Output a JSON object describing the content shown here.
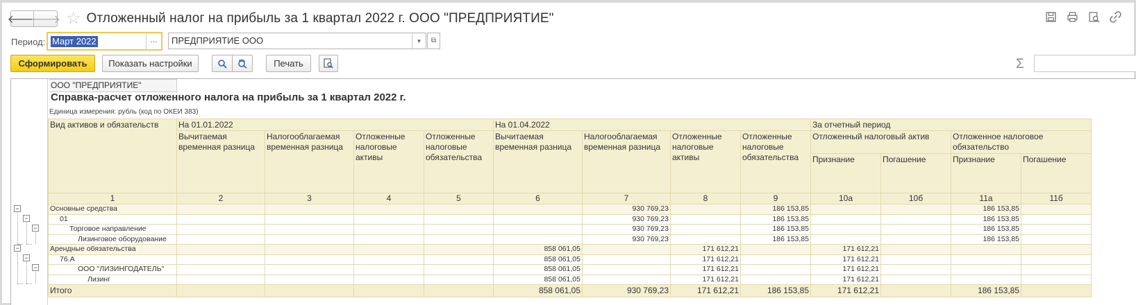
{
  "window": {
    "title": "Отложенный налог на прибыль за 1 квартал 2022 г. ООО \"ПРЕДПРИЯТИЕ\"",
    "back_glyph": "🡐",
    "forward_glyph": "🡒",
    "star_glyph": "☆"
  },
  "filters": {
    "period_label": "Период:",
    "period_value": "Март 2022",
    "period_select_glyph": "...",
    "organization_value": "ПРЕДПРИЯТИЕ ООО",
    "dropdown_glyph": "▾",
    "open_glyph": "⧉"
  },
  "toolbar": {
    "generate_label": "Сформировать",
    "settings_label": "Показать настройки",
    "print_label": "Печать",
    "sigma_glyph": "Σ"
  },
  "report": {
    "org_name": "ООО \"ПРЕДПРИЯТИЕ\"",
    "title": "Справка-расчет отложенного налога на прибыль за 1 квартал 2022 г.",
    "unit": "Единица измерения: рубль (код по ОКЕИ 383)",
    "headers": {
      "kind": "Вид активов и обязательств",
      "start": "На 01.01.2022",
      "end": "На 01.04.2022",
      "period": "За отчетный период",
      "deferred_asset": "Отложенный налоговый актив",
      "deferred_liability": "Отложенное налоговое обязательство",
      "deductible": "Вычитаемая временная разница",
      "taxable": "Налогооблагаемая временная разница",
      "assets": "Отложенные налоговые активы",
      "liabilities": "Отложенные налоговые обязательства",
      "recognition": "Признание",
      "repayment": "Погашение"
    },
    "column_numbers": [
      "1",
      "2",
      "3",
      "4",
      "5",
      "6",
      "7",
      "8",
      "9",
      "10а",
      "10б",
      "11а",
      "11б"
    ],
    "rows": [
      {
        "label": "Основные средства",
        "indent": 0,
        "group": true,
        "c6": "",
        "c7": "930 769,23",
        "c8": "",
        "c9": "186 153,85",
        "c10a": "",
        "c11a": "186 153,85"
      },
      {
        "label": "01",
        "indent": 1,
        "group": false,
        "c6": "",
        "c7": "930 769,23",
        "c8": "",
        "c9": "186 153,85",
        "c10a": "",
        "c11a": "186 153,85"
      },
      {
        "label": "Торговое направление",
        "indent": 2,
        "group": false,
        "c6": "",
        "c7": "930 769,23",
        "c8": "",
        "c9": "186 153,85",
        "c10a": "",
        "c11a": "186 153,85"
      },
      {
        "label": "Лизинговое оборудование",
        "indent": 3,
        "group": false,
        "c6": "",
        "c7": "930 769,23",
        "c8": "",
        "c9": "186 153,85",
        "c10a": "",
        "c11a": "186 153,85"
      },
      {
        "label": "Арендные обязательства",
        "indent": 0,
        "group": true,
        "c6": "858 061,05",
        "c7": "",
        "c8": "171 612,21",
        "c9": "",
        "c10a": "171 612,21",
        "c11a": ""
      },
      {
        "label": "76.А",
        "indent": 1,
        "group": false,
        "c6": "858 061,05",
        "c7": "",
        "c8": "171 612,21",
        "c9": "",
        "c10a": "171 612,21",
        "c11a": ""
      },
      {
        "label": "ООО \"ЛИЗИНГОДАТЕЛЬ\"",
        "indent": 3,
        "group": false,
        "c6": "858 061,05",
        "c7": "",
        "c8": "171 612,21",
        "c9": "",
        "c10a": "171 612,21",
        "c11a": ""
      },
      {
        "label": "Лизинг",
        "indent": 4,
        "group": false,
        "c6": "858 061,05",
        "c7": "",
        "c8": "171 612,21",
        "c9": "",
        "c10a": "171 612,21",
        "c11a": ""
      }
    ],
    "total": {
      "label": "Итого",
      "c6": "858 061,05",
      "c7": "930 769,23",
      "c8": "171 612,21",
      "c9": "186 153,85",
      "c10a": "171 612,21",
      "c11a": "186 153,85"
    }
  }
}
